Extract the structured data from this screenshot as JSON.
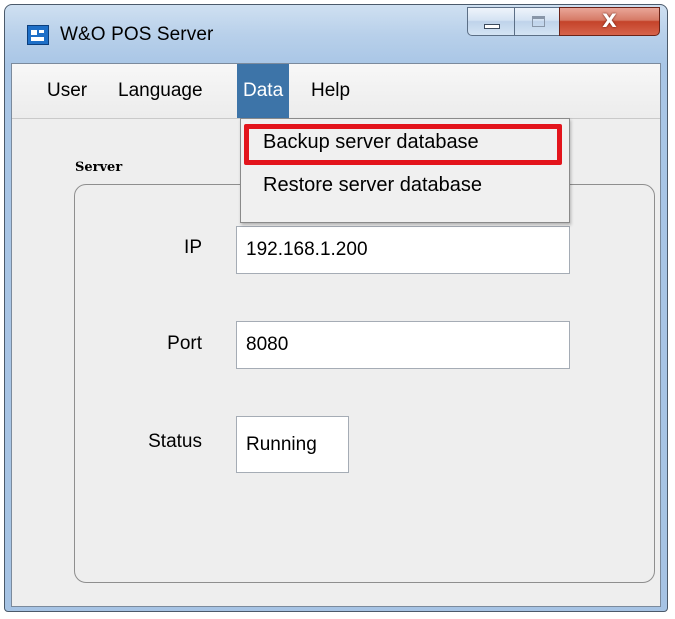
{
  "window": {
    "title": "W&O POS Server",
    "icon": "app-icon",
    "controls": {
      "minimize": "minimize-icon",
      "maximize": "maximize-icon",
      "close_glyph": "X"
    }
  },
  "menubar": {
    "items": [
      {
        "label": "User"
      },
      {
        "label": "Language"
      },
      {
        "label": "Data",
        "active": true
      },
      {
        "label": "Help"
      }
    ]
  },
  "data_menu": {
    "items": [
      {
        "label": "Backup server database",
        "highlighted": true
      },
      {
        "label": "Restore server database"
      }
    ]
  },
  "server": {
    "group_label": "Server",
    "ip_label": "IP",
    "ip_value": "192.168.1.200",
    "port_label": "Port",
    "port_value": "8080",
    "status_label": "Status",
    "status_value": "Running"
  },
  "colors": {
    "active_menu": "#3d74a8",
    "highlight_border": "#e3141c"
  }
}
